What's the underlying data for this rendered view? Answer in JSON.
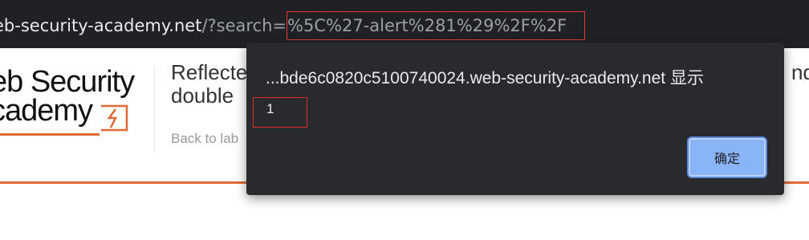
{
  "browser": {
    "url_host": "eb-security-academy.net",
    "url_path": "/?search=",
    "url_param": "%5C%27-alert%281%29%2F%2F"
  },
  "page": {
    "logo_line1": "eb Security",
    "logo_line2": "cademy",
    "title_line1": "Reflecte",
    "title_line2": "double",
    "title_fragment_right": "nd",
    "back_link": "Back to lab"
  },
  "alert": {
    "title": "...bde6c0820c5100740024.web-security-academy.net 显示",
    "message": "1",
    "ok_label": "确定"
  },
  "colors": {
    "accent_orange": "#e06a36",
    "dialog_bg": "#292a2d",
    "button_blue": "#8ab4f8",
    "highlight_red": "#e53935"
  }
}
